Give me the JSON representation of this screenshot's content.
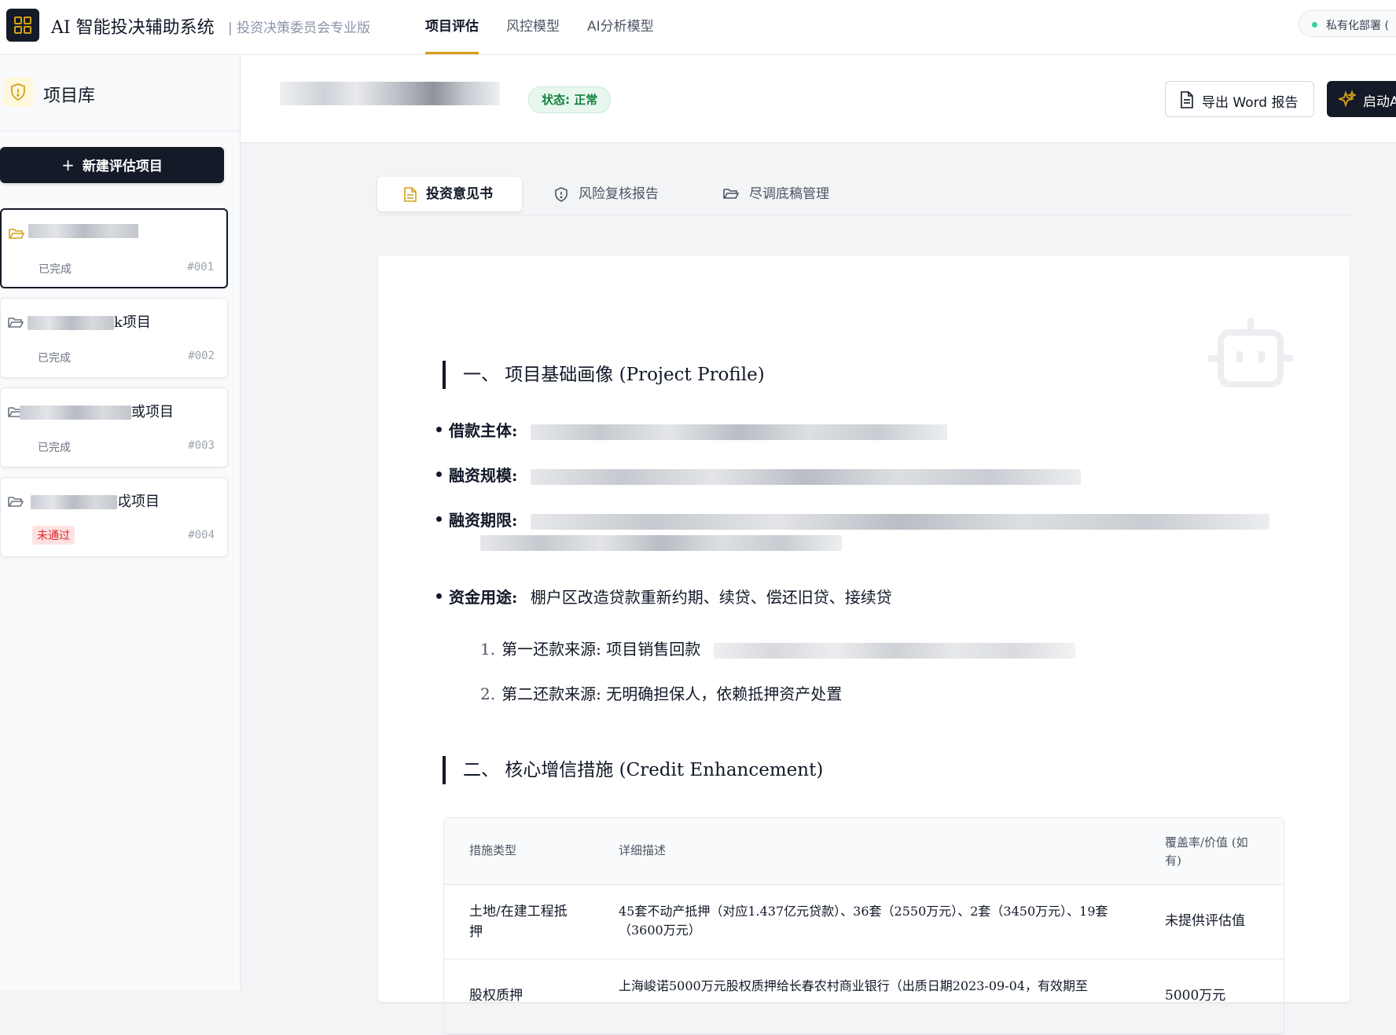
{
  "app": {
    "title": "AI 智能投决辅助系统",
    "subtitle": "| 投资决策委员会专业版",
    "nav": [
      "项目评估",
      "风控模型",
      "AI分析模型"
    ],
    "deploy_label": "私有化部署 (",
    "colors": {
      "accent": "#d4a017",
      "dark": "#141a27",
      "success": "#15803d",
      "danger": "#dc2626"
    }
  },
  "sidebar": {
    "title": "项目库",
    "new_button": "新建评估项目",
    "projects": [
      {
        "name_visible": "",
        "status": "已完成",
        "id": "#001"
      },
      {
        "name_visible": "k项目",
        "status": "已完成",
        "id": "#002"
      },
      {
        "name_visible": "或项目",
        "status": "已完成",
        "id": "#003"
      },
      {
        "name_visible": "戉项目",
        "status": "未通过",
        "id": "#004"
      }
    ]
  },
  "header": {
    "status_badge": "状态: 正常",
    "export_button": "导出 Word 报告",
    "launch_button": "启动A"
  },
  "doc_tabs": [
    "投资意见书",
    "风险复核报告",
    "尽调底稿管理"
  ],
  "document": {
    "section1_title": "一、  项目基础画像 (Project Profile)",
    "bullets": {
      "borrower_label": "借款主体:",
      "scale_label": "融资规模:",
      "term_label": "融资期限:",
      "use_label": "资金用途:",
      "use_value": "棚户区改造贷款重新约期、续贷、偿还旧贷、接续贷"
    },
    "repayment": [
      {
        "num": "1.",
        "text": "第一还款来源:  项目销售回款"
      },
      {
        "num": "2.",
        "text": "第二还款来源:  无明确担保人，依赖抵押资产处置"
      }
    ],
    "section2_title": "二、  核心增信措施 (Credit Enhancement)",
    "table": {
      "headers": [
        "措施类型",
        "详细描述",
        "覆盖率/价值 (如有)"
      ],
      "rows": [
        {
          "type": "土地/在建工程抵押",
          "desc": "45套不动产抵押（对应1.437亿元贷款）、36套（2550万元）、2套（3450万元）、19套（3600万元）",
          "value": "未提供评估值"
        },
        {
          "type": "股权质押",
          "desc": "上海峻诺5000万元股权质押给长春农村商业银行（出质日期2023-09-04，有效期至",
          "value": "5000万元"
        }
      ]
    }
  }
}
